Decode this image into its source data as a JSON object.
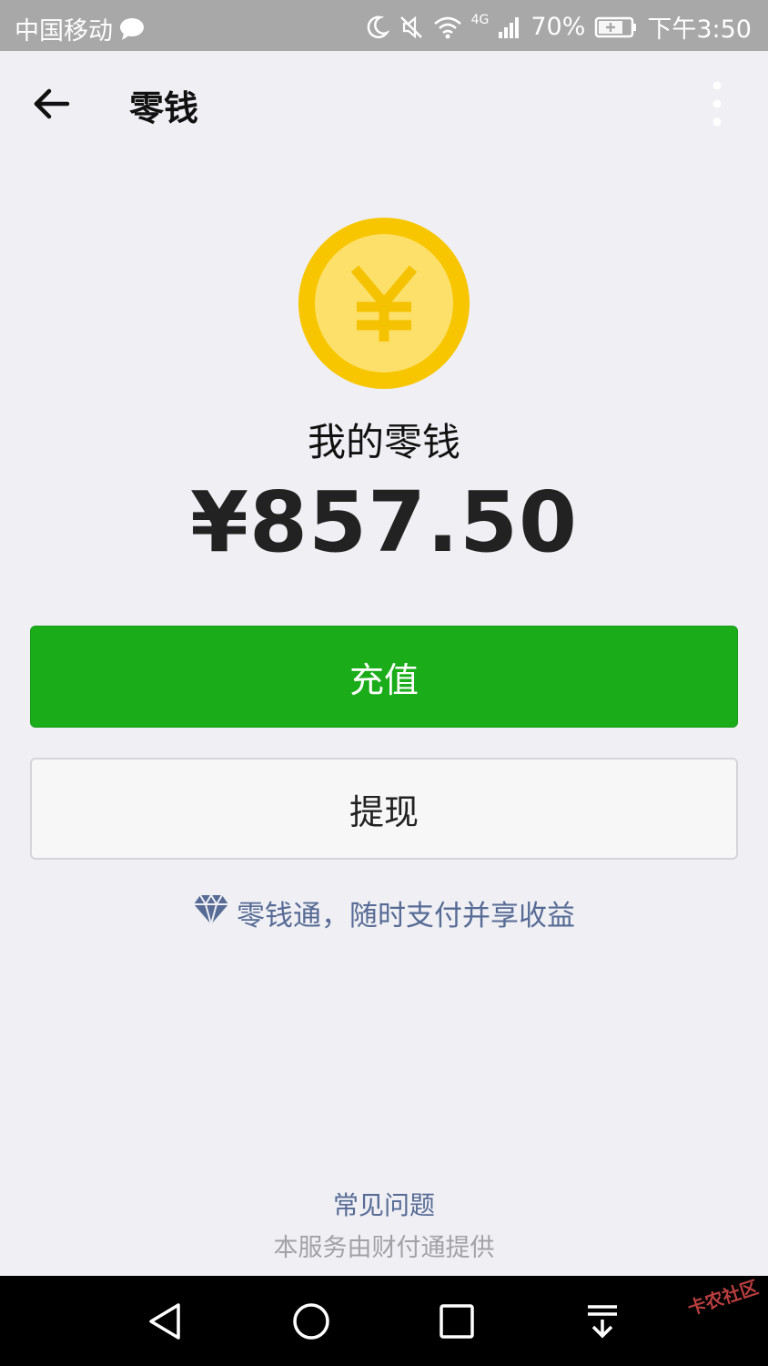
{
  "status_bar": {
    "carrier": "中国移动",
    "network": "4G",
    "battery": "70%",
    "time": "下午3:50"
  },
  "header": {
    "title": "零钱"
  },
  "wallet": {
    "label": "我的零钱",
    "amount": "¥857.50"
  },
  "actions": {
    "recharge_label": "充值",
    "withdraw_label": "提现"
  },
  "promo": {
    "text": "零钱通，随时支付并享收益"
  },
  "footer": {
    "faq": "常见问题",
    "provider": "本服务由财付通提供"
  },
  "watermark": {
    "text": "卡农社区"
  },
  "colors": {
    "primary_green": "#1aad19",
    "link_blue": "#576b95",
    "coin_yellow": "#f7c600"
  }
}
